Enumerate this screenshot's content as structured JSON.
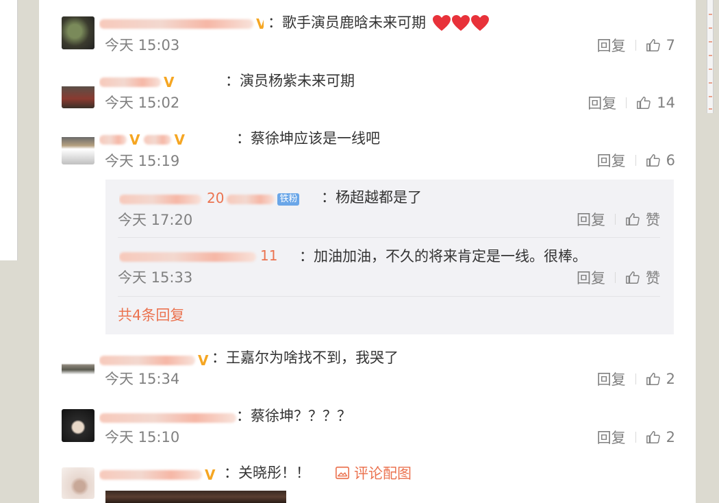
{
  "colors": {
    "accent": "#eb7350",
    "text": "#333333",
    "muted": "#808080",
    "reply_bg": "#f2f2f5",
    "heart": "#e8323a",
    "verified": "#f5a623"
  },
  "comments": [
    {
      "content": "：歌手演员鹿晗未来可期",
      "hearts": 3,
      "time": "今天 15:03",
      "reply_label": "回复",
      "likes": "7"
    },
    {
      "content": "：演员杨紫未来可期",
      "time": "今天 15:02",
      "reply_label": "回复",
      "likes": "14"
    },
    {
      "content": "：蔡徐坤应该是一线吧",
      "time": "今天 15:19",
      "reply_label": "回复",
      "likes": "6",
      "replies": [
        {
          "name_fragment": "20",
          "tag": "铁粉",
          "content": "：杨超越都是了",
          "time": "今天 17:20",
          "reply_label": "回复",
          "like_label": "赞"
        },
        {
          "name_fragment": "11",
          "content": "：加油加油，不久的将来肯定是一线。很棒。",
          "time": "今天 15:33",
          "reply_label": "回复",
          "like_label": "赞"
        }
      ],
      "more_replies": "共4条回复"
    },
    {
      "content": "：王嘉尔为啥找不到，我哭了",
      "time": "今天 15:34",
      "reply_label": "回复",
      "likes": "2"
    },
    {
      "content": "：蔡徐坤？？？？",
      "time": "今天 15:10",
      "reply_label": "回复",
      "likes": "2"
    },
    {
      "content": "：关晓彤！！",
      "pic_link": "评论配图"
    }
  ],
  "icons": {
    "like": "thumbs-up-icon",
    "heart": "heart-icon",
    "image": "image-icon",
    "verified": "verified-v-icon"
  }
}
